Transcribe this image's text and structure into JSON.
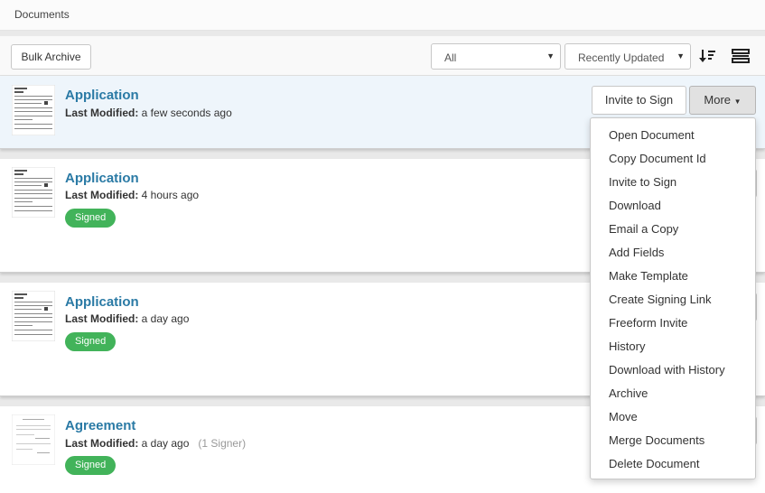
{
  "breadcrumb": "Documents",
  "toolbar": {
    "bulk_archive": "Bulk Archive",
    "filter": {
      "selected": "All"
    },
    "sort": {
      "selected": "Recently Updated"
    },
    "sort_icon": "sort-descending-icon",
    "view_icon": "list-view-icon"
  },
  "last_modified_label": "Last Modified:",
  "documents": [
    {
      "title": "Application",
      "modified": "a few seconds ago",
      "signers": "",
      "status": "",
      "selected": true
    },
    {
      "title": "Application",
      "modified": "4 hours ago",
      "signers": "",
      "status": "Signed",
      "selected": false
    },
    {
      "title": "Application",
      "modified": "a day ago",
      "signers": "",
      "status": "Signed",
      "selected": false
    },
    {
      "title": "Agreement",
      "modified": "a day ago",
      "signers": "(1 Signer)",
      "status": "Signed",
      "selected": false
    }
  ],
  "actions": {
    "invite": "Invite to Sign",
    "more": "More"
  },
  "more_menu": [
    "Open Document",
    "Copy Document Id",
    "Invite to Sign",
    "Download",
    "Email a Copy",
    "Add Fields",
    "Make Template",
    "Create Signing Link",
    "Freeform Invite",
    "History",
    "Download with History",
    "Archive",
    "Move",
    "Merge Documents",
    "Delete Document"
  ],
  "colors": {
    "link": "#2a7aa5",
    "signed_badge": "#42b35a",
    "selected_row": "#eef5fb"
  }
}
